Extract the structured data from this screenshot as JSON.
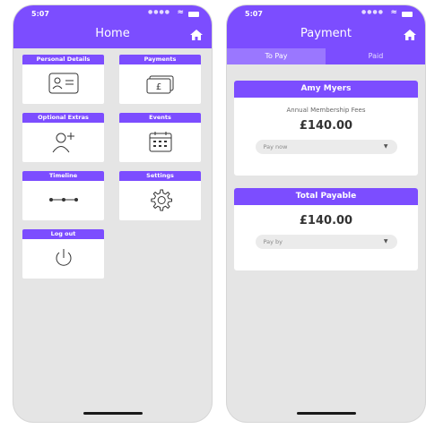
{
  "home_screen": {
    "status_time": "5:07",
    "title": "Home",
    "tiles": [
      {
        "label": "Personal Details"
      },
      {
        "label": "Payments"
      },
      {
        "label": "Optional Extras"
      },
      {
        "label": "Events"
      },
      {
        "label": "Timeline"
      },
      {
        "label": "Settings"
      },
      {
        "label": "Log out"
      }
    ]
  },
  "payment_screen": {
    "status_time": "5:07",
    "title": "Payment",
    "tabs": [
      {
        "label": "To Pay"
      },
      {
        "label": "Paid"
      }
    ],
    "member_card": {
      "name": "Amy Myers",
      "description": "Annual Membership Fees",
      "amount": "£140.00",
      "select_value": "Pay now"
    },
    "total_card": {
      "title": "Total Payable",
      "amount": "£140.00",
      "select_value": "Pay by"
    }
  },
  "colors": {
    "accent": "#7c4dff",
    "background": "#e5e5e5"
  }
}
